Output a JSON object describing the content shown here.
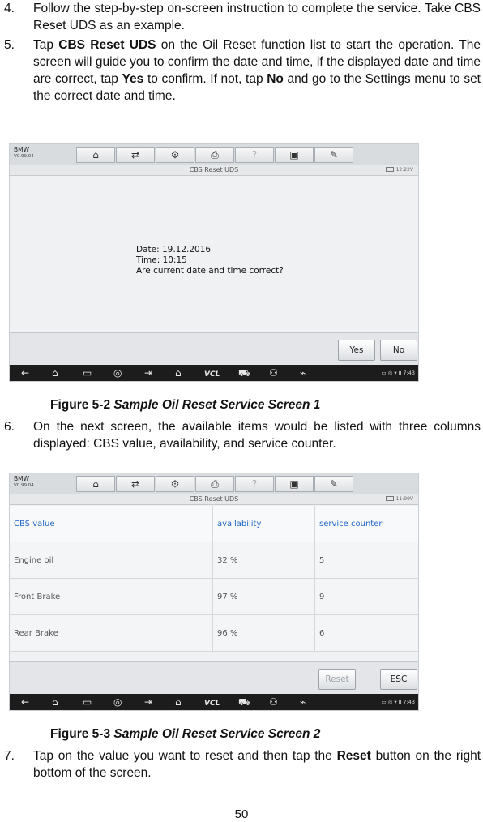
{
  "steps": {
    "s4": {
      "num": "4.",
      "text": "Follow the step-by-step on-screen instruction to complete the service. Take CBS Reset UDS as an example."
    },
    "s5": {
      "num": "5.",
      "parts": [
        "Tap ",
        "CBS Reset UDS",
        " on the Oil Reset function list to start the operation. The screen will guide you to confirm the date and time, if the displayed date and time are correct, tap ",
        "Yes",
        " to confirm. If not, tap ",
        "No",
        " and go to the Settings menu to set the correct date and time."
      ]
    },
    "s6": {
      "num": "6.",
      "text": "On the next screen, the available items would be listed with three columns displayed: CBS value, availability, and service counter."
    },
    "s7": {
      "num": "7.",
      "parts": [
        "Tap on the value you want to reset and then tap the ",
        "Reset",
        " button on the right bottom of the screen."
      ]
    }
  },
  "figures": {
    "fig1": {
      "prefix": "Figure 5-2 ",
      "title": "Sample Oil Reset Service Screen 1"
    },
    "fig2": {
      "prefix": "Figure 5-3 ",
      "title": "Sample Oil Reset Service Screen 2"
    }
  },
  "screen_common": {
    "brand": "BMW",
    "version": "V0.99.04",
    "toolbar_icons": [
      "home-icon",
      "vehicle-swap-icon",
      "gear-icon",
      "printer-icon",
      "help-icon",
      "save-icon",
      "pen-icon"
    ],
    "toolbar_glyphs": [
      "⌂",
      "⇄",
      "⚙",
      "⎙",
      "?",
      "▣",
      "✎"
    ],
    "window_title": "CBS Reset UDS",
    "nav_glyphs": [
      "←",
      "⌂",
      "▭",
      "◎",
      "⇥",
      "⌂",
      "VCL",
      "⛟",
      "⚇",
      "⌁"
    ],
    "nav_icons": [
      "back-icon",
      "home-icon",
      "recent-apps-icon",
      "browser-icon",
      "screenshot-icon",
      "maxi-home-icon",
      "vcl-icon",
      "car-icon",
      "service-icon",
      "connection-icon"
    ]
  },
  "screen1": {
    "clock": "12:22V",
    "message": [
      "Date: 19.12.2016",
      "Time: 10:15",
      "Are current date and time correct?"
    ],
    "yes_label": "Yes",
    "no_label": "No",
    "status_time": "7:43"
  },
  "screen2": {
    "clock": "11:99V",
    "headers": [
      "CBS value",
      "availability",
      "service counter"
    ],
    "rows": [
      [
        "Engine oil",
        "32 %",
        "5"
      ],
      [
        "Front Brake",
        "97 %",
        "9"
      ],
      [
        "Rear Brake",
        "96 %",
        "6"
      ]
    ],
    "reset_label": "Reset",
    "esc_label": "ESC",
    "status_time": "7:43"
  },
  "page_number": "50"
}
